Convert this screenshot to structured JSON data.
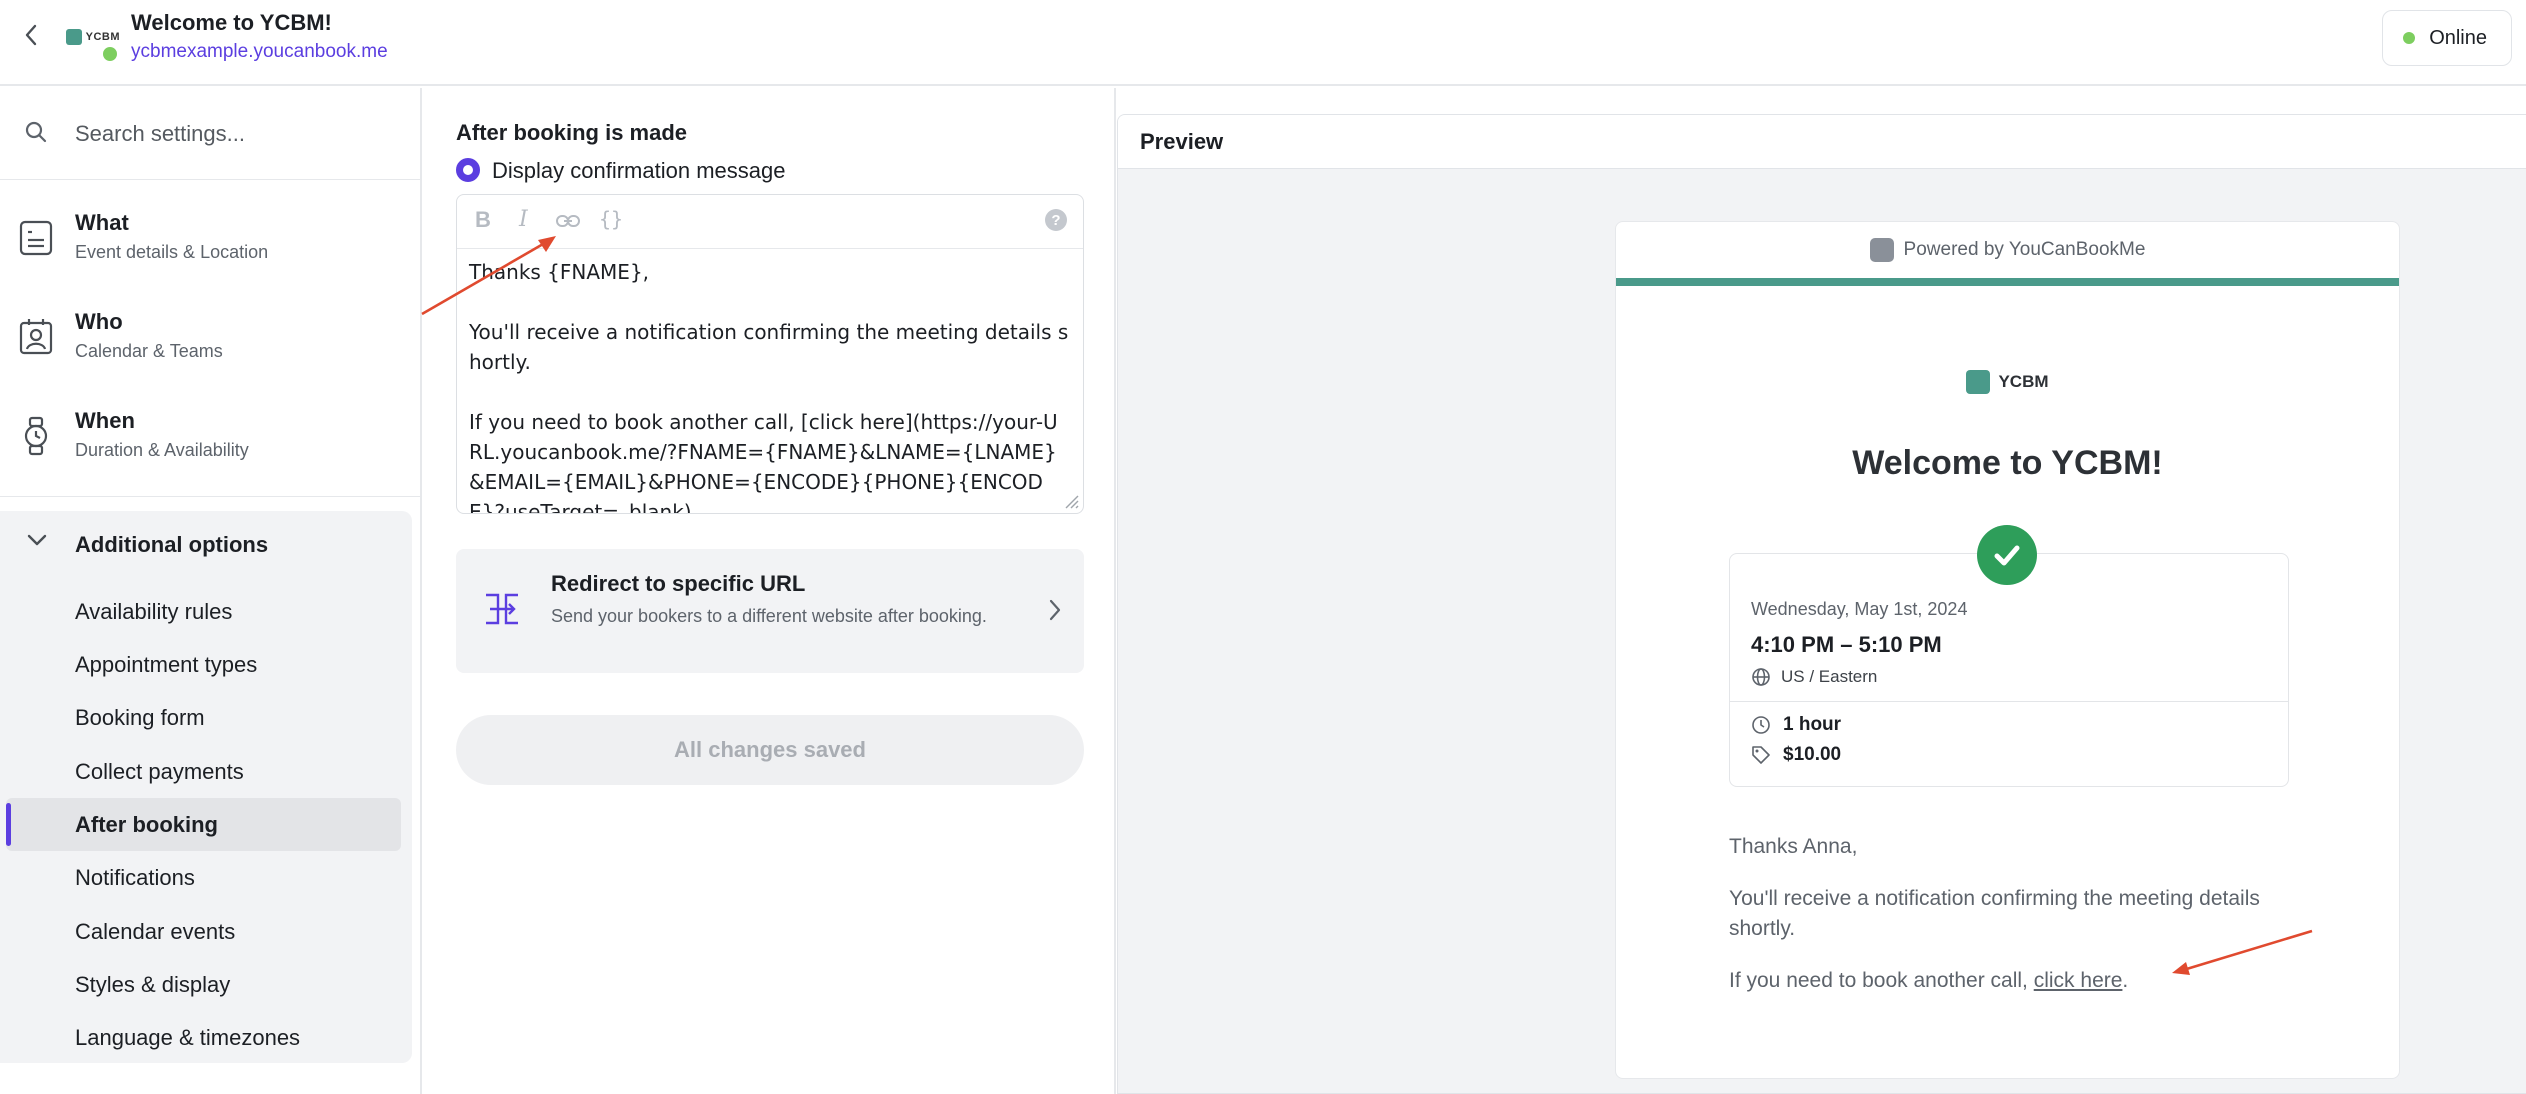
{
  "header": {
    "logo_text": "YCBM",
    "title": "Welcome to YCBM!",
    "url": "ycbmexample.youcanbook.me",
    "status": "Online"
  },
  "sidebar": {
    "search_placeholder": "Search settings...",
    "main_items": [
      {
        "label": "What",
        "sub": "Event details & Location"
      },
      {
        "label": "Who",
        "sub": "Calendar & Teams"
      },
      {
        "label": "When",
        "sub": "Duration & Availability"
      }
    ],
    "additional_label": "Additional options",
    "sub_items": [
      "Availability rules",
      "Appointment types",
      "Booking form",
      "Collect payments",
      "After booking",
      "Notifications",
      "Calendar events",
      "Styles & display",
      "Language & timezones"
    ],
    "active_item": "After booking"
  },
  "settings": {
    "section_title": "After booking is made",
    "radio_label": "Display confirmation message",
    "editor_text": "Thanks {FNAME},\n\nYou'll receive a notification confirming the meeting details shortly.\n\nIf you need to book another call, [click here](https://your-URL.youcanbook.me/?FNAME={FNAME}&LNAME={LNAME}&EMAIL={EMAIL}&PHONE={ENCODE}{PHONE}{ENCODE}?useTarget=_blank)",
    "toolbar": {
      "bold": "B",
      "italic": "I",
      "vars": "{}",
      "help": "?"
    },
    "redirect_title": "Redirect to specific URL",
    "redirect_desc": "Send your bookers to a different website after booking.",
    "save_label": "All changes saved"
  },
  "preview": {
    "title": "Preview",
    "powered_by": "Powered by YouCanBookMe",
    "brand": "YCBM",
    "welcome": "Welcome to YCBM!",
    "date": "Wednesday, May 1st, 2024",
    "time": "4:10 PM – 5:10 PM",
    "timezone": "US / Eastern",
    "duration": "1 hour",
    "price": "$10.00",
    "msg_greeting": "Thanks Anna,",
    "msg_body": "You'll receive a notification confirming the meeting details shortly.",
    "msg_link_prefix": "If you need to book another call, ",
    "msg_link": "click here",
    "msg_link_suffix": "."
  },
  "colors": {
    "accent": "#5b3ee0",
    "brand_teal": "#4a9a8a",
    "online": "#7dce5f",
    "success": "#2e9e5a",
    "annotation_arrow": "#e04a2f"
  }
}
